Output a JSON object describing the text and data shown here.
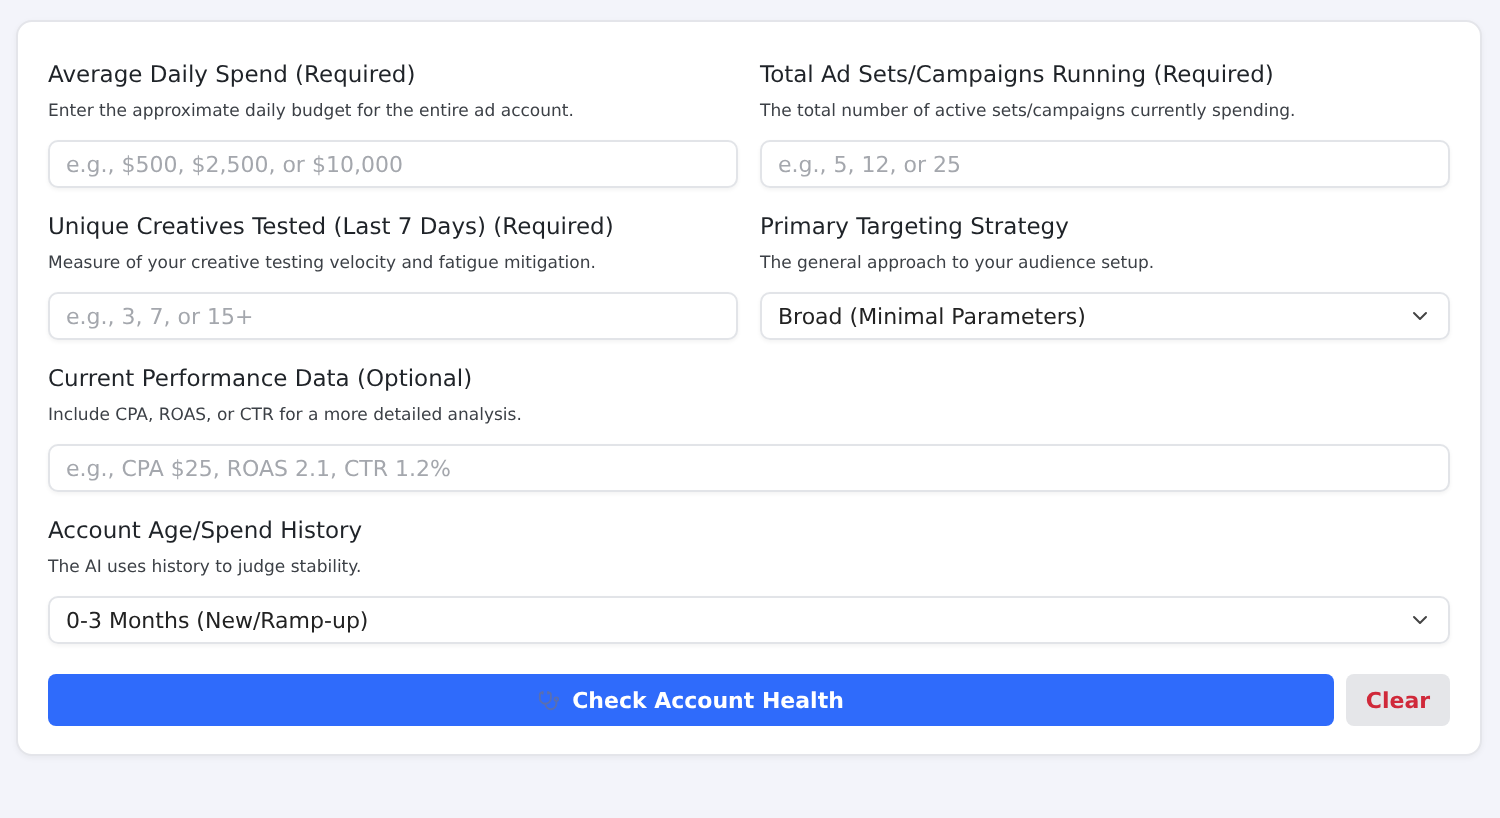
{
  "fields": [
    {
      "kind": "text",
      "wide": false,
      "label": "Average Daily Spend (Required)",
      "description": "Enter the approximate daily budget for the entire ad account.",
      "placeholder": "e.g., $500, $2,500, or $10,000"
    },
    {
      "kind": "text",
      "wide": false,
      "label": "Total Ad Sets/Campaigns Running (Required)",
      "description": "The total number of active sets/campaigns currently spending.",
      "placeholder": "e.g., 5, 12, or 25"
    },
    {
      "kind": "text",
      "wide": false,
      "label": "Unique Creatives Tested (Last 7 Days) (Required)",
      "description": "Measure of your creative testing velocity and fatigue mitigation.",
      "placeholder": "e.g., 3, 7, or 15+"
    },
    {
      "kind": "select",
      "wide": false,
      "label": "Primary Targeting Strategy",
      "description": "The general approach to your audience setup.",
      "value": "Broad (Minimal Parameters)"
    },
    {
      "kind": "text",
      "wide": true,
      "label": "Current Performance Data (Optional)",
      "description": "Include CPA, ROAS, or CTR for a more detailed analysis.",
      "placeholder": "e.g., CPA $25, ROAS 2.1, CTR 1.2%"
    },
    {
      "kind": "select",
      "wide": true,
      "label": "Account Age/Spend History",
      "description": "The AI uses history to judge stability.",
      "value": "0-3 Months (New/Ramp-up)"
    }
  ],
  "actions": {
    "submit": "Check Account Health",
    "clear": "Clear"
  }
}
